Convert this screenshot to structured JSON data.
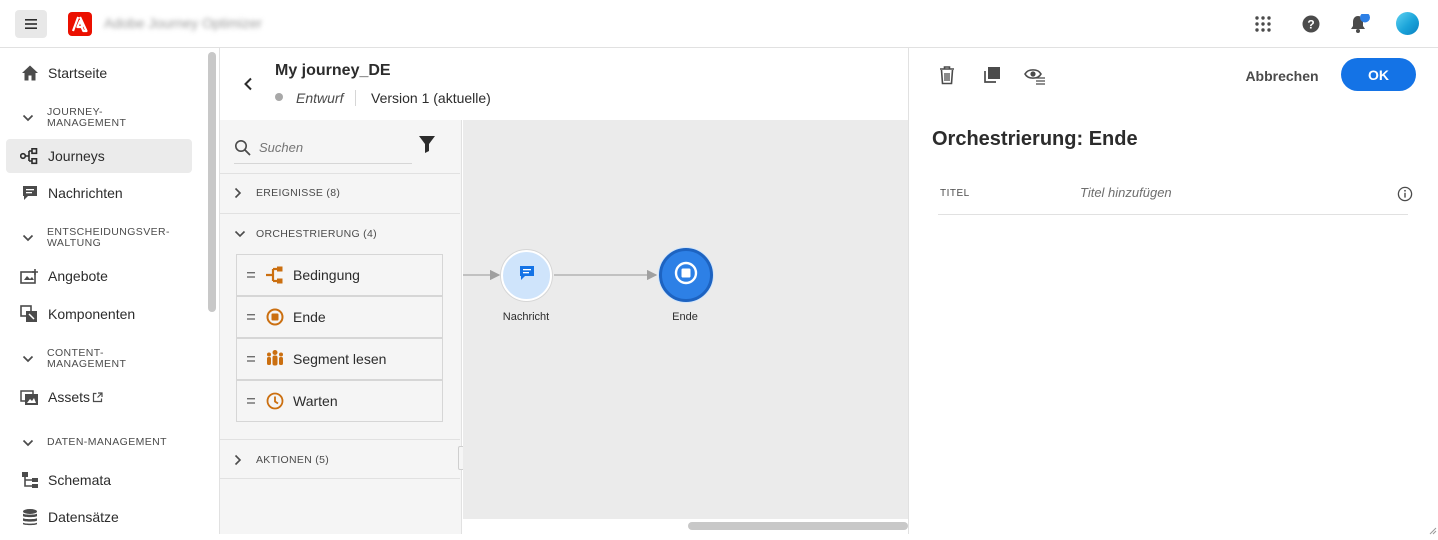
{
  "header": {
    "app_name": "Adobe Journey Optimizer",
    "menu_icon": "hamburger-icon",
    "logo_icon": "adobe-logo",
    "right_icons": [
      "apps-grid-icon",
      "help-icon",
      "bell-icon",
      "avatar"
    ]
  },
  "sidebar": {
    "items": [
      {
        "label": "Startseite",
        "icon": "home-icon"
      },
      {
        "section": "JOURNEY-\nMANAGEMENT"
      },
      {
        "label": "Journeys",
        "icon": "journey-icon",
        "active": true
      },
      {
        "label": "Nachrichten",
        "icon": "message-icon"
      },
      {
        "section": "ENTSCHEIDUNGSVER-\nWALTUNG"
      },
      {
        "label": "Angebote",
        "icon": "offers-icon"
      },
      {
        "label": "Komponenten",
        "icon": "components-icon"
      },
      {
        "section": "CONTENT-\nMANAGEMENT"
      },
      {
        "label": "Assets",
        "icon": "assets-icon",
        "external": true
      },
      {
        "section": "DATEN-MANAGEMENT"
      },
      {
        "label": "Schemata",
        "icon": "schema-icon"
      },
      {
        "label": "Datensätze",
        "icon": "datasets-icon"
      }
    ]
  },
  "journey": {
    "title": "My journey_DE",
    "status": "Entwurf",
    "version": "Version 1 (aktuelle)"
  },
  "palette": {
    "search_placeholder": "Suchen",
    "categories": {
      "events": "EREIGNISSE (8)",
      "orchestration": "ORCHESTRIERUNG (4)",
      "actions": "AKTIONEN (5)"
    },
    "activities": [
      {
        "label": "Bedingung",
        "icon": "condition-icon"
      },
      {
        "label": "Ende",
        "icon": "end-icon"
      },
      {
        "label": "Segment lesen",
        "icon": "read-segment-icon"
      },
      {
        "label": "Warten",
        "icon": "wait-icon"
      }
    ]
  },
  "canvas": {
    "nodes": [
      {
        "label": "Nachricht",
        "icon": "message-node-icon"
      },
      {
        "label": "Ende",
        "icon": "end-node-icon"
      }
    ]
  },
  "right_panel": {
    "cancel_label": "Abbrechen",
    "ok_label": "OK",
    "title": "Orchestrierung: Ende",
    "field_label": "TITEL",
    "field_placeholder": "Titel hinzufügen"
  },
  "colors": {
    "accent": "#1473e6",
    "orchestration": "#cb6f10",
    "node_light": "#cfe4fb",
    "node_selected": "#2d80e6",
    "brand": "#eb1000"
  }
}
